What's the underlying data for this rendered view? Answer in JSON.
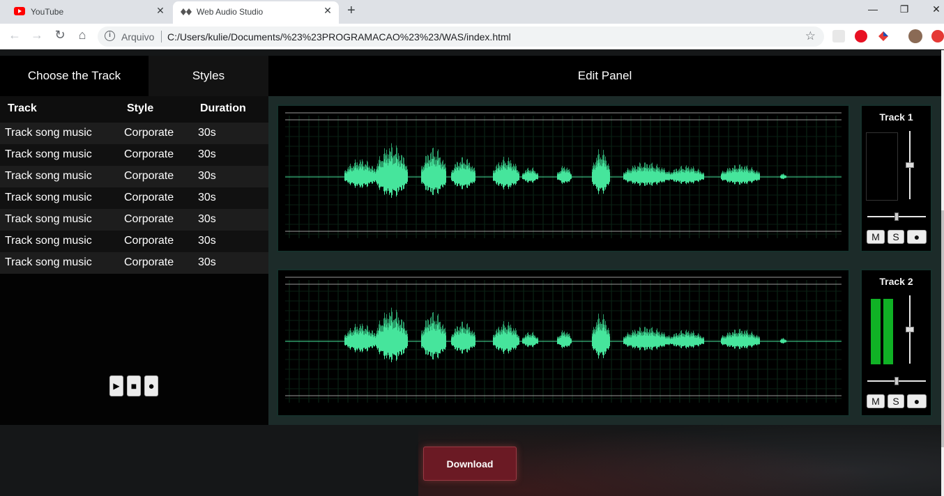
{
  "browser": {
    "tabs": [
      {
        "title": "YouTube",
        "active": false,
        "icon": "youtube-icon"
      },
      {
        "title": "Web Audio Studio",
        "active": true,
        "icon": "waveform-icon"
      }
    ],
    "new_tab_symbol": "+",
    "window_controls": [
      "—",
      "❐",
      "✕"
    ],
    "nav": {
      "back": "←",
      "forward": "→",
      "reload": "↻",
      "home": "⌂"
    },
    "address": {
      "scheme_label": "Arquivo",
      "url": "C:/Users/kulie/Documents/%23%23PROGRAMACAO%23%23/WAS/index.html"
    }
  },
  "app": {
    "nav": {
      "choose_track": "Choose the Track",
      "styles": "Styles",
      "edit_panel": "Edit Panel"
    },
    "table": {
      "headers": [
        "Track",
        "Style",
        "Duration"
      ],
      "rows": [
        [
          "Track song music",
          "Corporate",
          "30s"
        ],
        [
          "Track song music",
          "Corporate",
          "30s"
        ],
        [
          "Track song music",
          "Corporate",
          "30s"
        ],
        [
          "Track song music",
          "Corporate",
          "30s"
        ],
        [
          "Track song music",
          "Corporate",
          "30s"
        ],
        [
          "Track song music",
          "Corporate",
          "30s"
        ],
        [
          "Track song music",
          "Corporate",
          "30s"
        ]
      ]
    },
    "transport": {
      "play": "▶",
      "stop": "■",
      "record": "●"
    },
    "tracks": [
      {
        "name": "Track 1",
        "mute": "M",
        "solo": "S",
        "rec": "●",
        "level_left": 0.0,
        "level_right": 0.0,
        "volume": 0.5,
        "pan": 0.5
      },
      {
        "name": "Track 2",
        "mute": "M",
        "solo": "S",
        "rec": "●",
        "level_left": 0.98,
        "level_right": 0.98,
        "volume": 0.5,
        "pan": 0.5
      }
    ],
    "download_label": "Download",
    "colors": {
      "waveform": "#46e59c",
      "waveform_dark": "#2a9b68",
      "meter": "#10b225",
      "download": "#6b1a24",
      "panel": "#1c2b29"
    }
  }
}
